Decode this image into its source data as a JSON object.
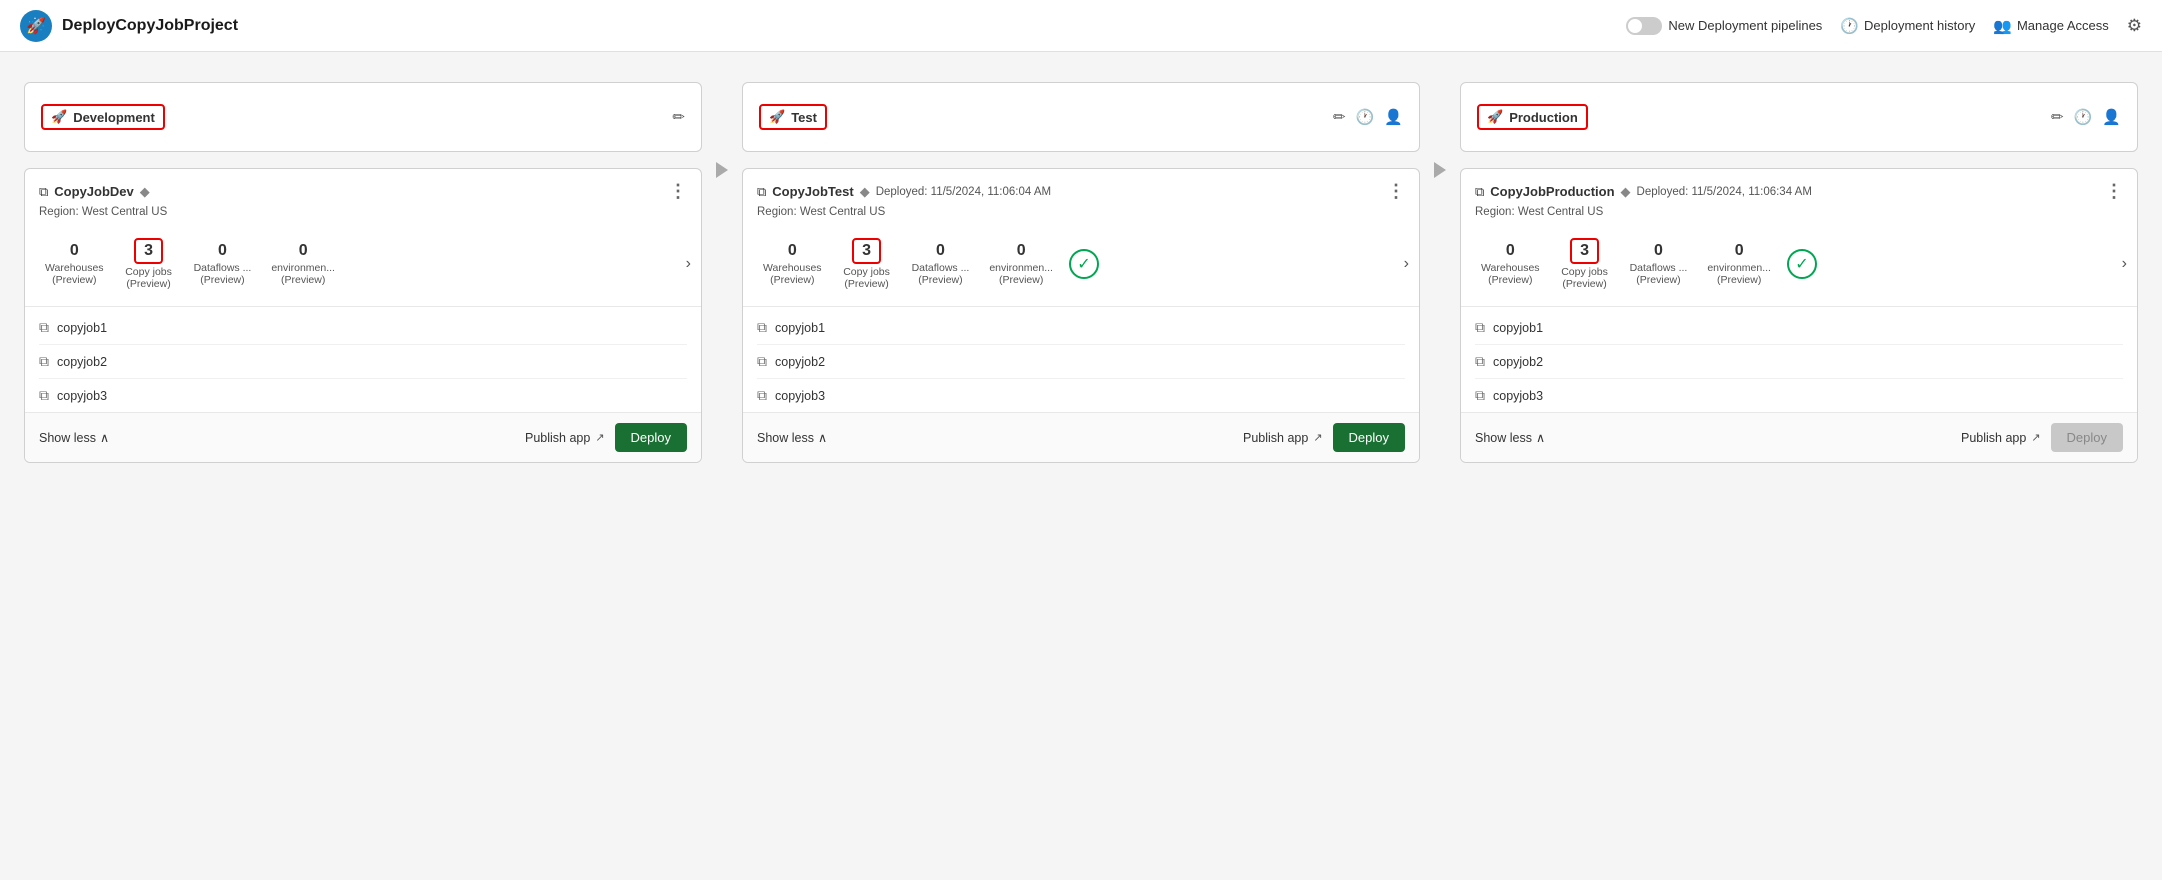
{
  "header": {
    "app_icon": "🚀",
    "app_title": "DeployCopyJobProject",
    "toggle_label": "New Deployment pipelines",
    "deployment_history": "Deployment history",
    "manage_access": "Manage Access"
  },
  "stages": [
    {
      "id": "development",
      "name": "Development",
      "header_actions": [
        "edit"
      ],
      "card_title": "CopyJobDev",
      "has_diamond": true,
      "deployed_text": "",
      "region": "Region: West Central US",
      "metrics": [
        {
          "count": "0",
          "label": "Warehouses\n(Preview)",
          "highlighted": false
        },
        {
          "count": "3",
          "label": "Copy jobs\n(Preview)",
          "highlighted": true
        },
        {
          "count": "0",
          "label": "Dataflows ...\n(Preview)",
          "highlighted": false
        },
        {
          "count": "0",
          "label": "environmen...\n(Preview)",
          "highlighted": false
        }
      ],
      "has_deployed_badge": false,
      "items": [
        "copyjob1",
        "copyjob2",
        "copyjob3"
      ],
      "show_less": "Show less",
      "publish_label": "Publish app",
      "deploy_label": "Deploy",
      "deploy_disabled": false
    },
    {
      "id": "test",
      "name": "Test",
      "header_actions": [
        "edit",
        "history",
        "assign"
      ],
      "card_title": "CopyJobTest",
      "has_diamond": true,
      "deployed_text": "Deployed: 11/5/2024, 11:06:04 AM",
      "region": "Region: West Central US",
      "metrics": [
        {
          "count": "0",
          "label": "Warehouses\n(Preview)",
          "highlighted": false
        },
        {
          "count": "3",
          "label": "Copy jobs\n(Preview)",
          "highlighted": true
        },
        {
          "count": "0",
          "label": "Dataflows ...\n(Preview)",
          "highlighted": false
        },
        {
          "count": "0",
          "label": "environmen...\n(Preview)",
          "highlighted": false
        }
      ],
      "has_deployed_badge": true,
      "items": [
        "copyjob1",
        "copyjob2",
        "copyjob3"
      ],
      "show_less": "Show less",
      "publish_label": "Publish app",
      "deploy_label": "Deploy",
      "deploy_disabled": false
    },
    {
      "id": "production",
      "name": "Production",
      "header_actions": [
        "edit",
        "history",
        "assign"
      ],
      "card_title": "CopyJobProduction",
      "has_diamond": true,
      "deployed_text": "Deployed: 11/5/2024, 11:06:34 AM",
      "region": "Region: West Central US",
      "metrics": [
        {
          "count": "0",
          "label": "Warehouses\n(Preview)",
          "highlighted": false
        },
        {
          "count": "3",
          "label": "Copy jobs\n(Preview)",
          "highlighted": true
        },
        {
          "count": "0",
          "label": "Dataflows ...\n(Preview)",
          "highlighted": false
        },
        {
          "count": "0",
          "label": "environmen...\n(Preview)",
          "highlighted": false
        }
      ],
      "has_deployed_badge": true,
      "items": [
        "copyjob1",
        "copyjob2",
        "copyjob3"
      ],
      "show_less": "Show less",
      "publish_label": "Publish app",
      "deploy_label": "Deploy",
      "deploy_disabled": true
    }
  ]
}
